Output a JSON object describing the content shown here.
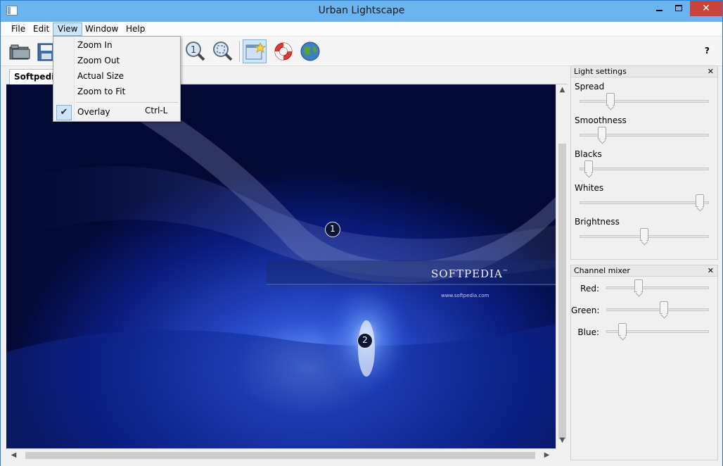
{
  "window": {
    "title": "Urban Lightscape"
  },
  "menubar": {
    "items": [
      "File",
      "Edit",
      "View",
      "Window",
      "Help"
    ],
    "active": "View"
  },
  "view_menu": {
    "items": [
      "Zoom In",
      "Zoom Out",
      "Actual Size",
      "Zoom to Fit"
    ],
    "overlay_label": "Overlay",
    "overlay_shortcut": "Ctrl-L",
    "overlay_checked": true
  },
  "toolbar": {
    "icons": [
      "open-folder-icon",
      "save-disk-icon",
      "zoom-actual-size-icon",
      "zoom-to-fit-icon",
      "overlay-icon",
      "help-lifebuoy-icon",
      "web-globe-icon"
    ],
    "help_label": "?"
  },
  "document": {
    "tab_label": "Softpedia",
    "markers": [
      "1",
      "2"
    ],
    "logo_text": "SOFTPEDIA",
    "logo_trademark": "™",
    "logo_url": "www.softpedia.com"
  },
  "light_settings": {
    "title": "Light settings",
    "close_label": "✕",
    "sliders": [
      {
        "label": "Spread",
        "level": 0.22
      },
      {
        "label": "Smoothness",
        "level": 0.15
      },
      {
        "label": "Blacks",
        "level": 0.04
      },
      {
        "label": "Whites",
        "level": 0.96
      },
      {
        "label": "Brightness",
        "level": 0.5
      }
    ]
  },
  "channel_mixer": {
    "title": "Channel mixer",
    "close_label": "✕",
    "sliders": [
      {
        "label": "Red:",
        "level": 0.3
      },
      {
        "label": "Green:",
        "level": 0.57
      },
      {
        "label": "Blue:",
        "level": 0.13
      }
    ]
  },
  "colors": {
    "titlebar": "#6cb4f0",
    "close_button": "#c7433b",
    "menu_highlight": "#cde4f7",
    "canvas_bg": "#02072a"
  }
}
